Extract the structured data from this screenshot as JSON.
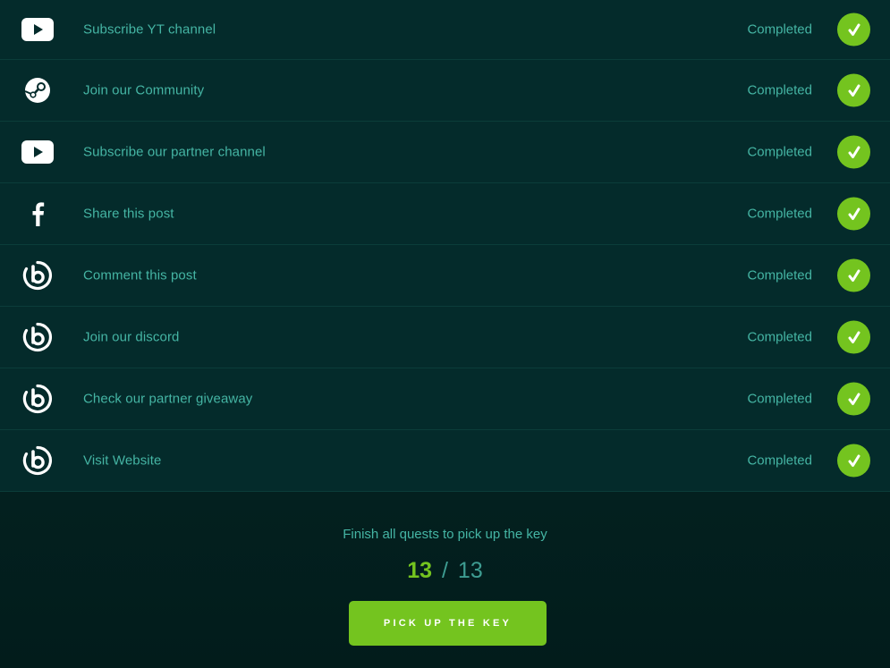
{
  "quests": [
    {
      "icon": "youtube-icon",
      "title": "Subscribe YT channel",
      "status": "Completed"
    },
    {
      "icon": "steam-icon",
      "title": "Join our Community",
      "status": "Completed"
    },
    {
      "icon": "youtube-icon",
      "title": "Subscribe our partner channel",
      "status": "Completed"
    },
    {
      "icon": "facebook-icon",
      "title": "Share this post",
      "status": "Completed"
    },
    {
      "icon": "brand-b-icon",
      "title": "Comment this post",
      "status": "Completed"
    },
    {
      "icon": "brand-b-icon",
      "title": "Join our discord",
      "status": "Completed"
    },
    {
      "icon": "brand-b-icon",
      "title": "Check our partner giveaway",
      "status": "Completed"
    },
    {
      "icon": "brand-b-icon",
      "title": "Visit Website",
      "status": "Completed"
    }
  ],
  "footer": {
    "note": "Finish all quests to pick up the key",
    "progress_current": "13",
    "progress_separator": "/",
    "progress_total": "13",
    "button_label": "PICK UP THE KEY"
  },
  "colors": {
    "background": "#042b2b",
    "accent": "#74c41f",
    "text": "#45b5a4",
    "divider": "#0b3d3a"
  }
}
